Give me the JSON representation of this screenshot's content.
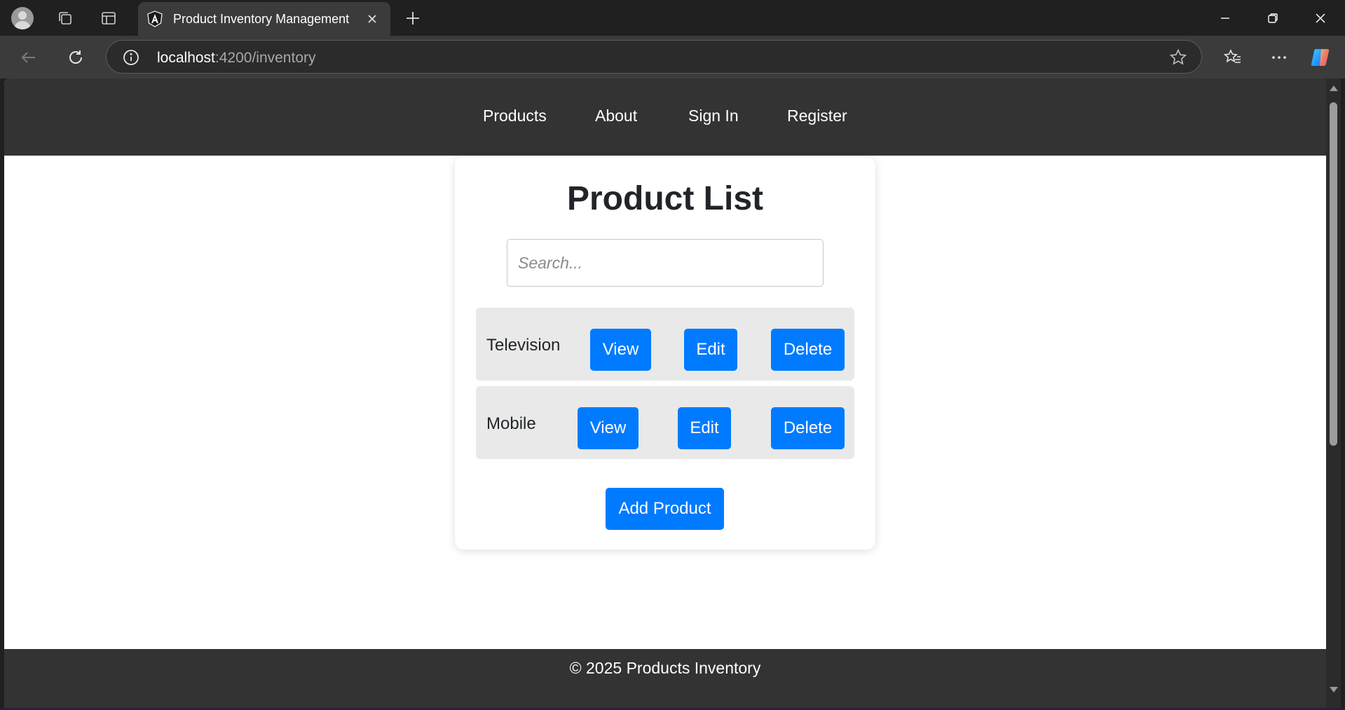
{
  "browser": {
    "tab_title": "Product Inventory Management",
    "url_host": "localhost",
    "url_rest": ":4200/inventory"
  },
  "nav": {
    "products": "Products",
    "about": "About",
    "sign_in": "Sign In",
    "register": "Register"
  },
  "page": {
    "title": "Product List",
    "search_placeholder": "Search...",
    "products": [
      {
        "name": "Television",
        "view": "View",
        "edit": "Edit",
        "delete": "Delete"
      },
      {
        "name": "Mobile",
        "view": "View",
        "edit": "Edit",
        "delete": "Delete"
      }
    ],
    "add_button": "Add Product"
  },
  "footer": {
    "text": "© 2025 Products Inventory"
  },
  "colors": {
    "accent": "#007bff",
    "navbar": "#333333",
    "row_bg": "#e9e9e9"
  }
}
